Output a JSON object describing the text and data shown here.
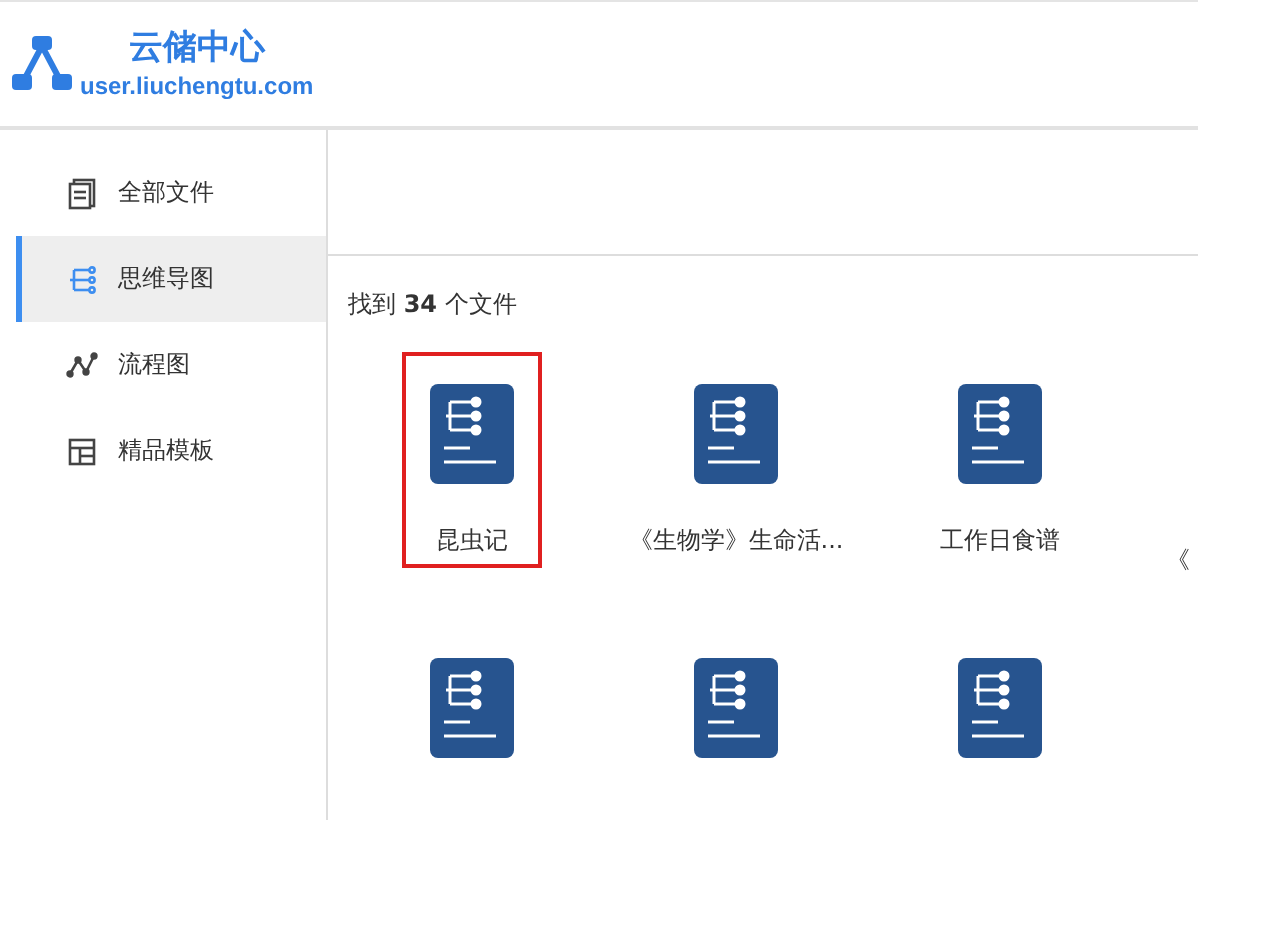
{
  "header": {
    "title": "云储中心",
    "url": "user.liuchengtu.com"
  },
  "sidebar": {
    "items": [
      {
        "kind": "files",
        "label": "全部文件",
        "selected": false
      },
      {
        "kind": "mindmap",
        "label": "思维导图",
        "selected": true
      },
      {
        "kind": "flow",
        "label": "流程图",
        "selected": false
      },
      {
        "kind": "template",
        "label": "精品模板",
        "selected": false
      }
    ]
  },
  "result_count": "找到 **34** 个文件",
  "files": [
    {
      "label": "昆虫记",
      "selected": true
    },
    {
      "label": "《生物学》生命活...",
      "selected": false
    },
    {
      "label": "工作日食谱",
      "selected": false
    },
    {
      "kind": "cut",
      "label": "《"
    },
    {
      "selected": false
    },
    {
      "selected": false
    },
    {
      "selected": false
    }
  ]
}
